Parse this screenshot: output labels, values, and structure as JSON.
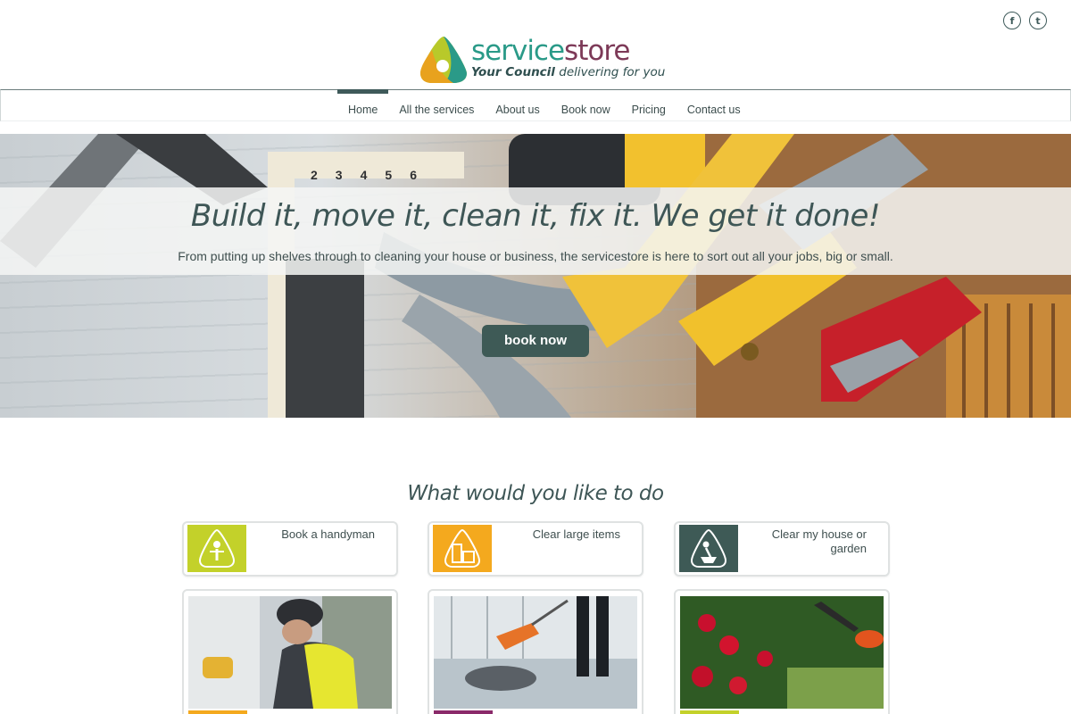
{
  "social": {
    "facebook": "f",
    "twitter": "t"
  },
  "logo": {
    "name_part1": "service",
    "name_part2": "store",
    "tagline_bold": "Your Council",
    "tagline_rest": " delivering for you"
  },
  "nav": {
    "items": [
      "Home",
      "All the services",
      "About us",
      "Book now",
      "Pricing",
      "Contact us"
    ],
    "active": "Home"
  },
  "hero": {
    "ruler_numbers": [
      "2",
      "3",
      "4",
      "5",
      "6"
    ],
    "title": "Build it, move it, clean it, fix it. We get it done!",
    "subtitle": "From putting up shelves through to cleaning your house or business, the servicestore is here to sort out all your jobs, big or small.",
    "button": "book now"
  },
  "section": {
    "title": "What would you like to do"
  },
  "services": [
    {
      "label": "Book a handyman",
      "color": "#c3d12a",
      "icon": "handyman-icon"
    },
    {
      "label": "Clear large items",
      "color": "#f4a91e",
      "icon": "appliances-icon"
    },
    {
      "label": "Clear my house or garden",
      "color": "#3e5a56",
      "icon": "garden-icon"
    }
  ],
  "photo_strip_colors": [
    "#f4a91e",
    "#8a2a6a",
    "#c3d12a"
  ],
  "colors": {
    "primary": "#3e5a56",
    "teal": "#2a9a88",
    "plum": "#7d3a58"
  }
}
